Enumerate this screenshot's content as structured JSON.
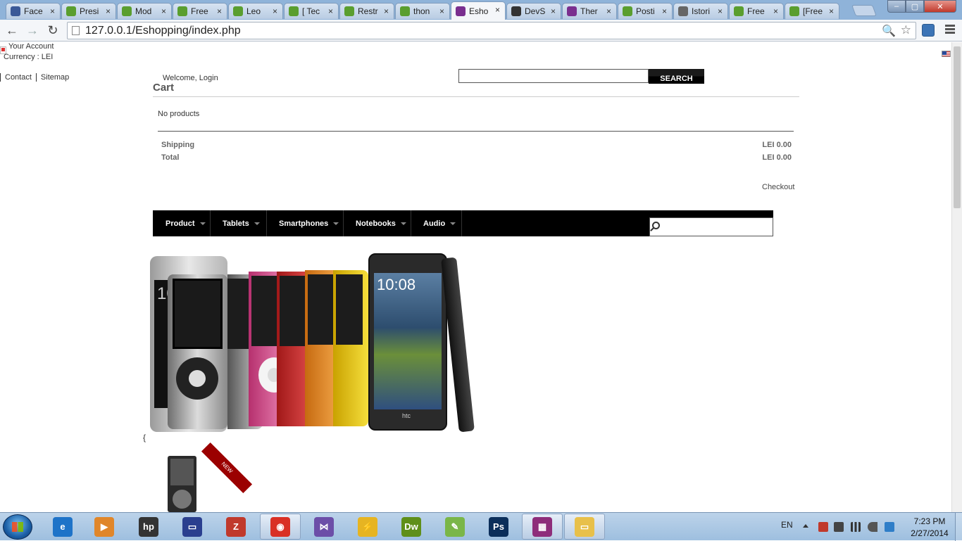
{
  "browser": {
    "tabs": [
      {
        "label": "Face",
        "favicon_color": "#3b5998",
        "active": false
      },
      {
        "label": "Presi",
        "favicon_color": "#5a9e2f",
        "active": false
      },
      {
        "label": "Mod",
        "favicon_color": "#5a9e2f",
        "active": false
      },
      {
        "label": "Free",
        "favicon_color": "#5a9e2f",
        "active": false
      },
      {
        "label": "Leo",
        "favicon_color": "#5a9e2f",
        "active": false
      },
      {
        "label": "[ Tec",
        "favicon_color": "#5a9e2f",
        "active": false
      },
      {
        "label": "Restr",
        "favicon_color": "#5a9e2f",
        "active": false
      },
      {
        "label": "thon",
        "favicon_color": "#5a9e2f",
        "active": false
      },
      {
        "label": "Esho",
        "favicon_color": "#7a2f8f",
        "active": true
      },
      {
        "label": "DevS",
        "favicon_color": "#333333",
        "active": false
      },
      {
        "label": "Ther",
        "favicon_color": "#7a2f8f",
        "active": false
      },
      {
        "label": "Posti",
        "favicon_color": "#5a9e2f",
        "active": false
      },
      {
        "label": "Istori",
        "favicon_color": "#666666",
        "active": false
      },
      {
        "label": "Free",
        "favicon_color": "#5a9e2f",
        "active": false
      },
      {
        "label": "[Free",
        "favicon_color": "#5a9e2f",
        "active": false
      }
    ],
    "tab_close_glyph": "×",
    "url": "127.0.0.1/Eshopping/index.php",
    "back_glyph": "←",
    "forward_glyph": "→",
    "reload_glyph": "↻",
    "zoom_glyph": "🔍",
    "star_glyph": "☆"
  },
  "page": {
    "account_link": "Your Account",
    "currency_label": "Currency :",
    "currency_value": "LEI",
    "contact_link": "Contact",
    "sitemap_link": "Sitemap",
    "welcome_text": "Welcome,",
    "login_link": "Login",
    "search_button": "SEARCH",
    "cart": {
      "title": "Cart",
      "empty_text": "No products",
      "shipping_label": "Shipping",
      "shipping_value": "LEI 0.00",
      "total_label": "Total",
      "total_value": "LEI 0.00",
      "checkout_link": "Checkout"
    },
    "menu": {
      "product": "Product",
      "tablets": "Tablets",
      "smartphones": "Smartphones",
      "notebooks": "Notebooks",
      "audio": "Audio"
    },
    "banner": {
      "clock_text": "10:08",
      "brand_text": "htc",
      "partial_clock_text": "10"
    },
    "stray_text": "{",
    "new_badge": "NEW"
  },
  "taskbar": {
    "apps": [
      {
        "name": "internet-explorer-icon",
        "label": "e",
        "color": "#1e73c8",
        "open": false
      },
      {
        "name": "media-player-icon",
        "label": "▶",
        "color": "#e0862a",
        "open": false
      },
      {
        "name": "hp-icon",
        "label": "hp",
        "color": "#333333",
        "open": false
      },
      {
        "name": "save-icon",
        "label": "▭",
        "color": "#2a3f8f",
        "open": false
      },
      {
        "name": "filezilla-icon",
        "label": "Z",
        "color": "#c0392b",
        "open": false
      },
      {
        "name": "chrome-icon",
        "label": "◉",
        "color": "#d93025",
        "open": true
      },
      {
        "name": "visual-studio-icon",
        "label": "⋈",
        "color": "#6c4ea8",
        "open": false
      },
      {
        "name": "tools-icon",
        "label": "⚡",
        "color": "#e6b422",
        "open": false
      },
      {
        "name": "dreamweaver-icon",
        "label": "Dw",
        "color": "#5f8f19",
        "open": false
      },
      {
        "name": "notepad-plus-icon",
        "label": "✎",
        "color": "#7ab648",
        "open": false
      },
      {
        "name": "photoshop-icon",
        "label": "Ps",
        "color": "#0b2e5a",
        "open": false
      },
      {
        "name": "winrar-icon",
        "label": "▦",
        "color": "#8e2d7a",
        "open": true
      },
      {
        "name": "explorer-folder-icon",
        "label": "▭",
        "color": "#e8c04a",
        "open": true
      }
    ],
    "language": "EN",
    "time": "7:23 PM",
    "date": "2/27/2014"
  }
}
